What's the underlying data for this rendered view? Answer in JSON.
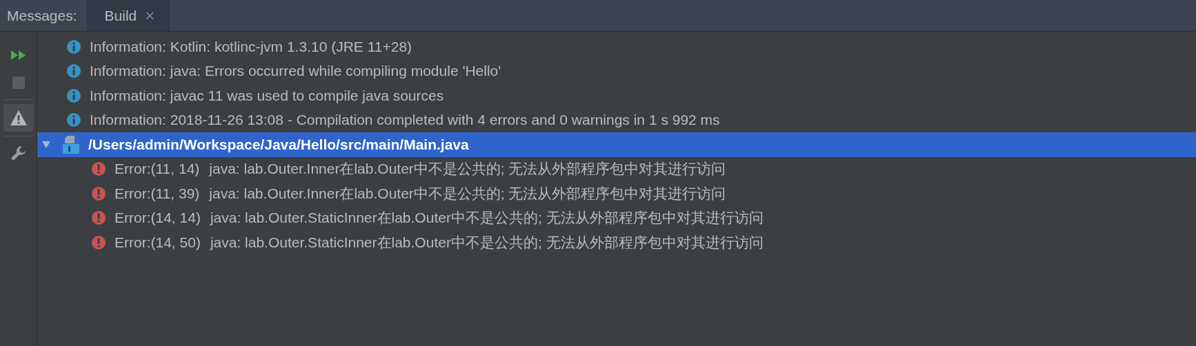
{
  "tab_strip": {
    "label": "Messages:",
    "tabs": [
      {
        "label": "Build",
        "selected": true,
        "close": "×"
      }
    ]
  },
  "toolbar": [
    {
      "kind": "rerun",
      "disabled": false
    },
    {
      "kind": "stop",
      "disabled": true
    },
    {
      "kind": "warnings",
      "on": true
    },
    {
      "kind": "settings",
      "disabled": false
    }
  ],
  "messages": [
    {
      "kind": "info",
      "text": "Information: Kotlin: kotlinc-jvm 1.3.10 (JRE 11+28)"
    },
    {
      "kind": "info",
      "text": "Information: java: Errors occurred while compiling module 'Hello'"
    },
    {
      "kind": "info",
      "text": "Information: javac 11 was used to compile java sources"
    },
    {
      "kind": "info",
      "text": "Information: 2018-11-26 13:08 - Compilation completed with 4 errors and 0 warnings in 1 s 992 ms"
    }
  ],
  "file_node": {
    "path": "/Users/admin/Workspace/Java/Hello/src/main/Main.java",
    "expanded": true,
    "selected": true,
    "children": [
      {
        "kind": "error",
        "location": "Error:(11, 14)",
        "message": "java: lab.Outer.Inner在lab.Outer中不是公共的; 无法从外部程序包中对其进行访问"
      },
      {
        "kind": "error",
        "location": "Error:(11, 39)",
        "message": "java: lab.Outer.Inner在lab.Outer中不是公共的; 无法从外部程序包中对其进行访问"
      },
      {
        "kind": "error",
        "location": "Error:(14, 14)",
        "message": "java: lab.Outer.StaticInner在lab.Outer中不是公共的; 无法从外部程序包中对其进行访问"
      },
      {
        "kind": "error",
        "location": "Error:(14, 50)",
        "message": "java: lab.Outer.StaticInner在lab.Outer中不是公共的; 无法从外部程序包中对其进行访问"
      }
    ]
  }
}
